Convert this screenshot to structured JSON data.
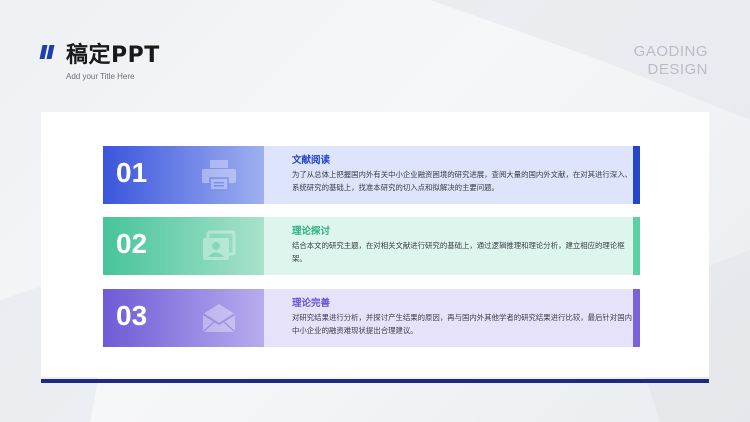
{
  "header": {
    "title": "稿定PPT",
    "subtitle": "Add your Title Here"
  },
  "brand": {
    "line1": "GAODING",
    "line2": "DESIGN"
  },
  "items": [
    {
      "number": "01",
      "heading": "文献阅读",
      "text": "为了从总体上把握国内外有关中小企业融资困境的研究进展，查阅大量的国内外文献，在对其进行深入、系统研究的基础上，找准本研究的切入点和拟解决的主要问题。",
      "icon": "printer-icon",
      "color": "#2446c9"
    },
    {
      "number": "02",
      "heading": "理论探讨",
      "text": "结合本文的研究主题，在对相关文献进行研究的基础上，通过逻辑推理和理论分析，建立相应的理论框架。",
      "icon": "image-gallery-icon",
      "color": "#5fcfa7"
    },
    {
      "number": "03",
      "heading": "理论完善",
      "text": "对研究结果进行分析，并探讨产生结果的原因，再与国内外其他学者的研究结果进行比较，最后针对国内中小企业的融资难现状提出合理建议。",
      "icon": "envelope-icon",
      "color": "#7a63d9"
    }
  ]
}
